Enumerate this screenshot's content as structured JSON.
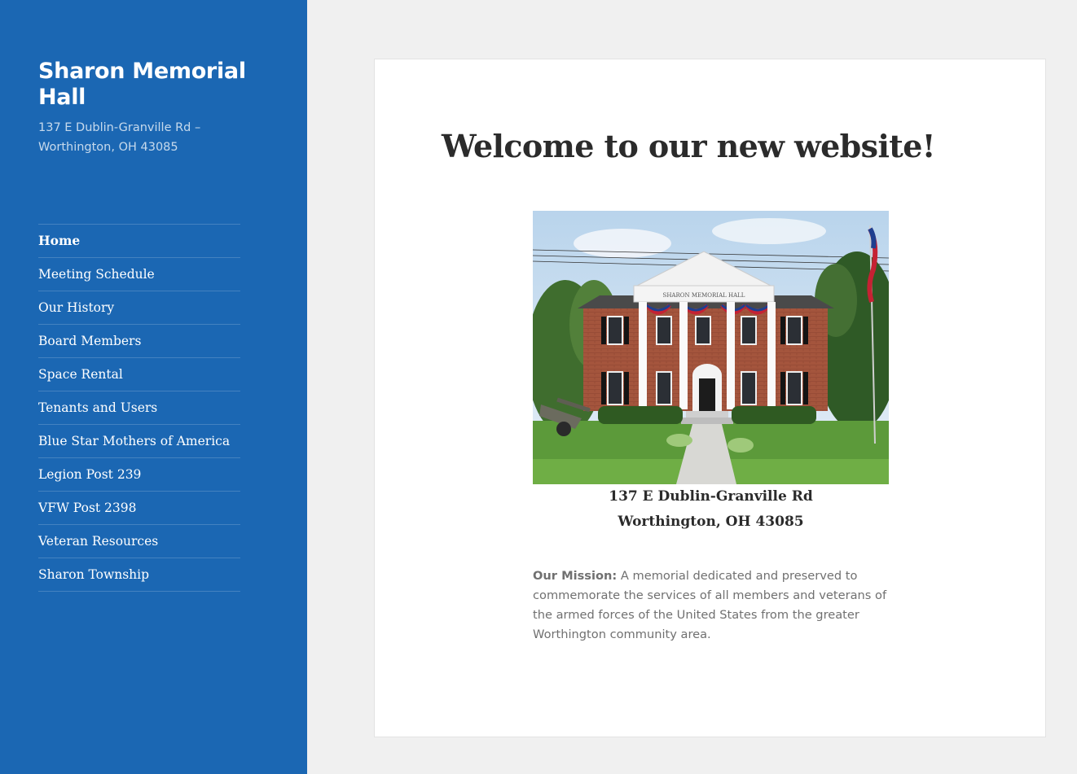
{
  "site": {
    "title": "Sharon Memorial Hall",
    "description": "137 E Dublin-Granville Rd – Worthington, OH 43085"
  },
  "nav": {
    "items": [
      {
        "label": "Home"
      },
      {
        "label": "Meeting Schedule"
      },
      {
        "label": "Our History"
      },
      {
        "label": "Board Members"
      },
      {
        "label": "Space Rental"
      },
      {
        "label": "Tenants and Users"
      },
      {
        "label": "Blue Star Mothers of America"
      },
      {
        "label": "Legion Post 239"
      },
      {
        "label": "VFW Post 2398"
      },
      {
        "label": "Veteran Resources"
      },
      {
        "label": "Sharon Township"
      }
    ]
  },
  "main": {
    "title": "Welcome to our new website!",
    "photo": {
      "building_sign": "SHARON MEMORIAL HALL"
    },
    "address_line1": "137 E Dublin-Granville Rd",
    "address_line2": "Worthington, OH 43085",
    "mission_label": "Our Mission:",
    "mission_text": "A memorial dedicated and preserved to commemorate the services of all members and veterans of the armed forces of the United States from the greater Worthington community area."
  },
  "colors": {
    "sidebar": "#1b67b3",
    "background": "#f0f0f0",
    "heading": "#2b2b2b",
    "body_text": "#707070"
  }
}
